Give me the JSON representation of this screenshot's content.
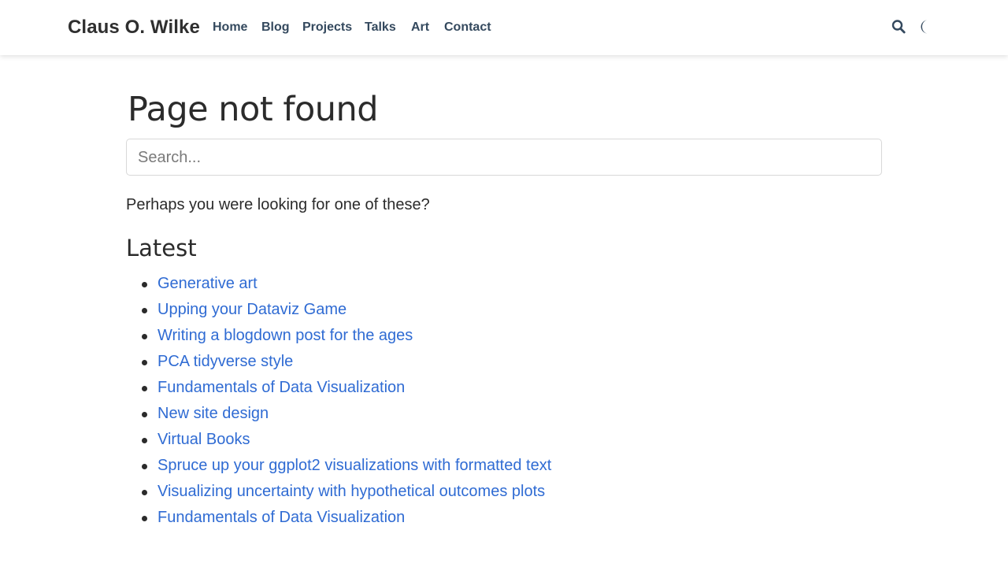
{
  "site": {
    "brand": "Claus O. Wilke"
  },
  "nav": {
    "items": [
      {
        "label": "Home"
      },
      {
        "label": "Blog"
      },
      {
        "label": "Projects"
      },
      {
        "label": "Talks"
      },
      {
        "label": "Art"
      },
      {
        "label": "Contact"
      }
    ],
    "search_icon": "search-icon",
    "theme_icon": "moon-icon"
  },
  "main": {
    "title": "Page not found",
    "search": {
      "placeholder": "Search...",
      "value": ""
    },
    "hint": "Perhaps you were looking for one of these?",
    "latest": {
      "heading": "Latest",
      "posts": [
        {
          "title": "Generative art"
        },
        {
          "title": "Upping your Dataviz Game"
        },
        {
          "title": "Writing a blogdown post for the ages"
        },
        {
          "title": "PCA tidyverse style"
        },
        {
          "title": "Fundamentals of Data Visualization"
        },
        {
          "title": "New site design"
        },
        {
          "title": "Virtual Books"
        },
        {
          "title": "Spruce up your ggplot2 visualizations with formatted text"
        },
        {
          "title": "Visualizing uncertainty with hypothetical outcomes plots"
        },
        {
          "title": "Fundamentals of Data Visualization"
        }
      ]
    }
  },
  "colors": {
    "link": "#2f6bd3",
    "nav_text": "#34495e",
    "text": "#2b2b2b",
    "background": "#ffffff"
  }
}
